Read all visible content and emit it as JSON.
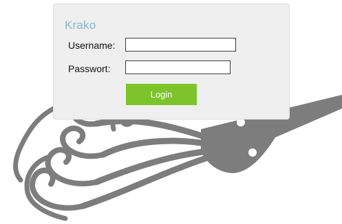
{
  "login": {
    "brand": "Krako",
    "username_label": "Username:",
    "username_value": "",
    "password_label": "Passwort:",
    "password_value": "",
    "login_button": "Login"
  },
  "colors": {
    "panel_background": "#efefef",
    "brand_text": "#8cb6cf",
    "login_button": "#7cc42a",
    "decoration": "#7d7d7d"
  },
  "decoration": {
    "icon": "ornate-whisk-graphic"
  }
}
